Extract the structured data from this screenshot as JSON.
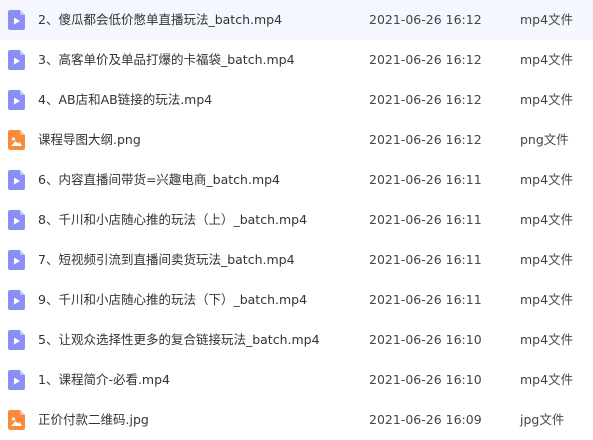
{
  "colors": {
    "video_icon": "#8b8ef5",
    "image_icon": "#fa8b3c"
  },
  "files": [
    {
      "icon": "video-file-icon",
      "name": "2、傻瓜都会低价憋单直播玩法_batch.mp4",
      "date": "2021-06-26 16:12",
      "type": "mp4文件"
    },
    {
      "icon": "video-file-icon",
      "name": "3、高客单价及单品打爆的卡福袋_batch.mp4",
      "date": "2021-06-26 16:12",
      "type": "mp4文件"
    },
    {
      "icon": "video-file-icon",
      "name": "4、AB店和AB链接的玩法.mp4",
      "date": "2021-06-26 16:12",
      "type": "mp4文件"
    },
    {
      "icon": "image-file-icon",
      "name": "课程导图大纲.png",
      "date": "2021-06-26 16:12",
      "type": "png文件"
    },
    {
      "icon": "video-file-icon",
      "name": "6、内容直播间带货=兴趣电商_batch.mp4",
      "date": "2021-06-26 16:11",
      "type": "mp4文件"
    },
    {
      "icon": "video-file-icon",
      "name": "8、千川和小店随心推的玩法（上）_batch.mp4",
      "date": "2021-06-26 16:11",
      "type": "mp4文件"
    },
    {
      "icon": "video-file-icon",
      "name": "7、短视频引流到直播间卖货玩法_batch.mp4",
      "date": "2021-06-26 16:11",
      "type": "mp4文件"
    },
    {
      "icon": "video-file-icon",
      "name": "9、千川和小店随心推的玩法（下）_batch.mp4",
      "date": "2021-06-26 16:11",
      "type": "mp4文件"
    },
    {
      "icon": "video-file-icon",
      "name": "5、让观众选择性更多的复合链接玩法_batch.mp4",
      "date": "2021-06-26 16:10",
      "type": "mp4文件"
    },
    {
      "icon": "video-file-icon",
      "name": "1、课程简介-必看.mp4",
      "date": "2021-06-26 16:10",
      "type": "mp4文件"
    },
    {
      "icon": "image-file-icon",
      "name": "正价付款二维码.jpg",
      "date": "2021-06-26 16:09",
      "type": "jpg文件"
    }
  ]
}
